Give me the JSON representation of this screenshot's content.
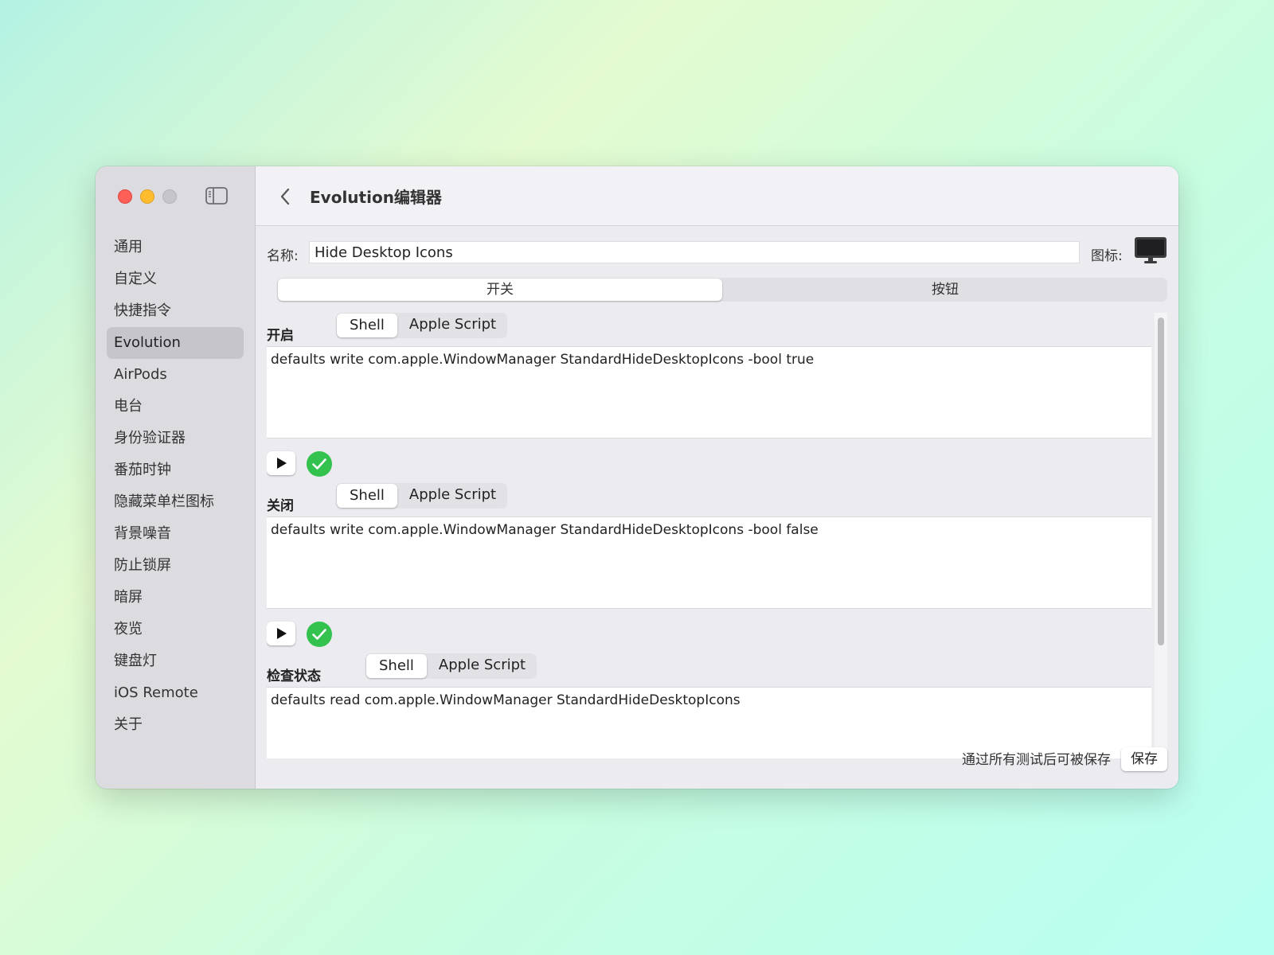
{
  "window": {
    "title": "Evolution编辑器"
  },
  "sidebar": {
    "items": [
      {
        "label": "通用"
      },
      {
        "label": "自定义"
      },
      {
        "label": "快捷指令"
      },
      {
        "label": "Evolution",
        "active": true
      },
      {
        "label": "AirPods"
      },
      {
        "label": "电台"
      },
      {
        "label": "身份验证器"
      },
      {
        "label": "番茄时钟"
      },
      {
        "label": "隐藏菜单栏图标"
      },
      {
        "label": "背景噪音"
      },
      {
        "label": "防止锁屏"
      },
      {
        "label": "暗屏"
      },
      {
        "label": "夜览"
      },
      {
        "label": "键盘灯"
      },
      {
        "label": "iOS Remote"
      },
      {
        "label": "关于"
      }
    ]
  },
  "form": {
    "name_label": "名称:",
    "name_value": "Hide Desktop Icons",
    "icon_label": "图标:",
    "icon_name": "display-icon"
  },
  "mode_tabs": {
    "switch_label": "开关",
    "button_label": "按钮",
    "selected": "开关"
  },
  "sections": {
    "on": {
      "label": "开启",
      "shell": "Shell",
      "applescript": "Apple Script",
      "selected": "Shell",
      "code": "defaults write com.apple.WindowManager StandardHideDesktopIcons -bool true",
      "status": "passed"
    },
    "off": {
      "label": "关闭",
      "shell": "Shell",
      "applescript": "Apple Script",
      "selected": "Shell",
      "code": "defaults write com.apple.WindowManager StandardHideDesktopIcons -bool false",
      "status": "passed"
    },
    "check": {
      "label": "检查状态",
      "shell": "Shell",
      "applescript": "Apple Script",
      "selected": "Shell",
      "code": "defaults read com.apple.WindowManager StandardHideDesktopIcons"
    }
  },
  "footer": {
    "hint": "通过所有测试后可被保存",
    "save_label": "保存"
  },
  "colors": {
    "close": "#fe5f57",
    "minimize": "#febc2e",
    "zoom": "#c6c5cb",
    "success": "#33c24d"
  }
}
